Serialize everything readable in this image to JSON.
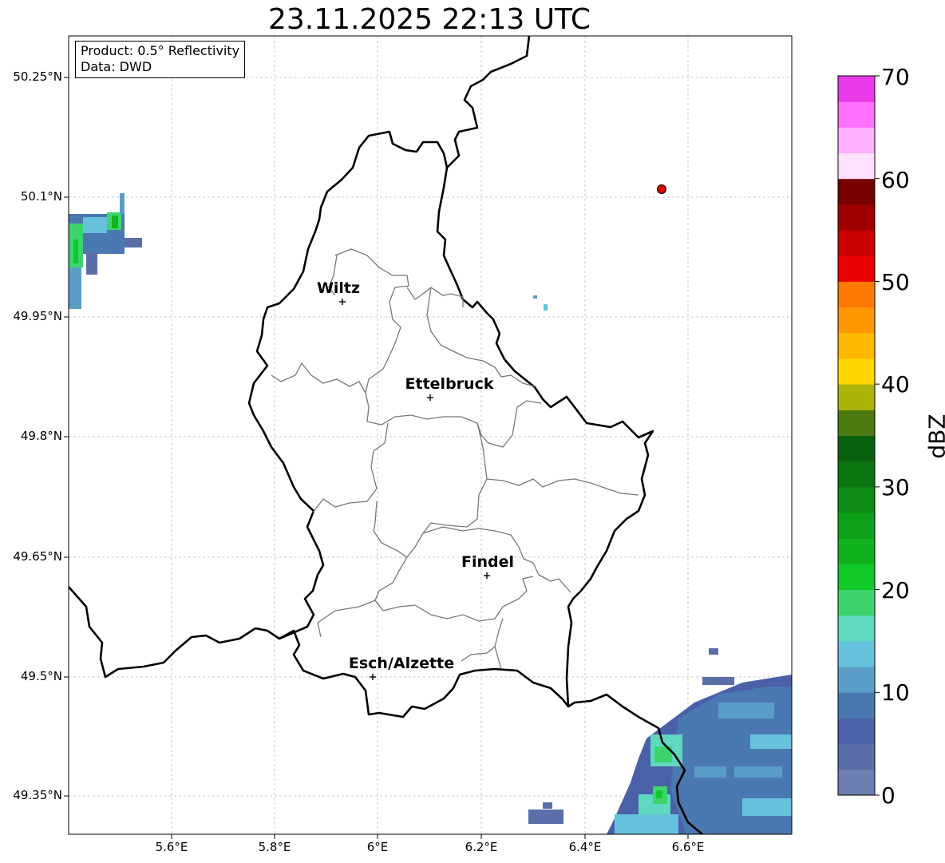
{
  "title": "23.11.2025 22:13 UTC",
  "info": {
    "product": "Product: 0.5° Reflectivity",
    "data_source": "Data: DWD"
  },
  "axes": {
    "y_ticks": [
      "50.25°N",
      "50.1°N",
      "49.95°N",
      "49.8°N",
      "49.65°N",
      "49.5°N",
      "49.35°N"
    ],
    "x_ticks": [
      "5.6°E",
      "5.8°E",
      "6°E",
      "6.2°E",
      "6.4°E",
      "6.6°E"
    ]
  },
  "cities": [
    {
      "name": "Wiltz"
    },
    {
      "name": "Ettelbruck"
    },
    {
      "name": "Findel"
    },
    {
      "name": "Esch/Alzette"
    }
  ],
  "colorbar": {
    "label": "dBZ",
    "ticks": [
      "0",
      "10",
      "20",
      "30",
      "40",
      "50",
      "60",
      "70"
    ],
    "colors": [
      "#6a7fb0",
      "#5a6fa8",
      "#4a60a8",
      "#4a78b0",
      "#5a9ec8",
      "#66c2dc",
      "#5fd8c0",
      "#3dd470",
      "#10c828",
      "#11b21e",
      "#0fa01a",
      "#0d8a16",
      "#0b7612",
      "#08600e",
      "#4a7a10",
      "#aab40a",
      "#ffd800",
      "#ffb800",
      "#ff9800",
      "#ff7800",
      "#e80000",
      "#c80000",
      "#a00000",
      "#780000",
      "#ffe0ff",
      "#ffb0ff",
      "#ff70ff",
      "#e83ae8"
    ]
  },
  "marker": {
    "color": "#e00000"
  }
}
